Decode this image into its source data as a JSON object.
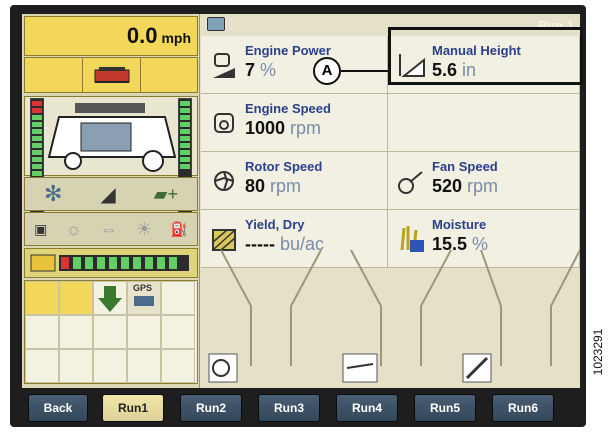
{
  "left_panel": {
    "speed": {
      "value": "0.0",
      "unit": "mph"
    },
    "icons": [
      "combine-header-icon",
      "combine-icon",
      "reel-speed-icon",
      "header-tilt-icon",
      "auger-icon",
      "light-icon",
      "gps-icon",
      "auto-steer-icon",
      "fuel-icon"
    ],
    "gps_label": "GPS"
  },
  "top_bar": {
    "title": "Run 1"
  },
  "tiles": {
    "engine_power": {
      "label": "Engine Power",
      "value": "7",
      "unit": "%"
    },
    "manual_height": {
      "label": "Manual Height",
      "value": "5.6",
      "unit": "in"
    },
    "engine_speed": {
      "label": "Engine Speed",
      "value": "1000",
      "unit": "rpm"
    },
    "rotor_speed": {
      "label": "Rotor Speed",
      "value": "80",
      "unit": "rpm"
    },
    "fan_speed": {
      "label": "Fan Speed",
      "value": "520",
      "unit": "rpm"
    },
    "yield_dry": {
      "label": "Yield, Dry",
      "value": "-----",
      "unit": "bu/ac"
    },
    "moisture": {
      "label": "Moisture",
      "value": "15.5",
      "unit": "%"
    }
  },
  "callout": {
    "letter": "A"
  },
  "buttons": [
    {
      "label": "Back",
      "active": false
    },
    {
      "label": "Run1",
      "active": true
    },
    {
      "label": "Run2",
      "active": false
    },
    {
      "label": "Run3",
      "active": false
    },
    {
      "label": "Run4",
      "active": false
    },
    {
      "label": "Run5",
      "active": false
    },
    {
      "label": "Run6",
      "active": false
    }
  ],
  "figure_id": "1023291",
  "colors": {
    "accent_yellow": "#f3d75a",
    "label_blue": "#2b3f8c",
    "button_blue": "#3f5468"
  }
}
